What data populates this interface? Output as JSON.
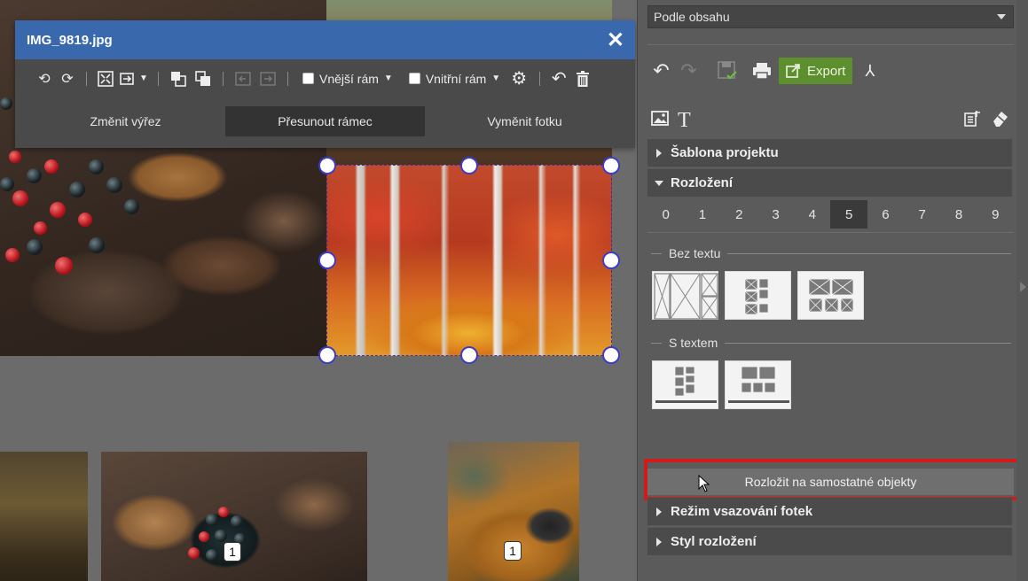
{
  "dialog": {
    "title": "IMG_9819.jpg",
    "toolbar": {
      "outer_frame_label": "Vnější rám",
      "inner_frame_label": "Vnitřní rám"
    },
    "tabs": [
      "Změnit výřez",
      "Přesunout rámec",
      "Vyměnit fotku"
    ],
    "active_tab": "Přesunout rámec"
  },
  "canvas": {
    "badges": [
      "1",
      "1"
    ]
  },
  "panel": {
    "layout_select": "Podle obsahu",
    "export_label": "Export",
    "sections": {
      "project_template": "Šablona projektu",
      "layout": "Rozložení",
      "photo_insertion_mode": "Režim vsazování fotek",
      "layout_style": "Styl rozložení"
    },
    "photo_counts": [
      "0",
      "1",
      "2",
      "3",
      "4",
      "5",
      "6",
      "7",
      "8",
      "9"
    ],
    "active_count": "5",
    "groups": {
      "without_text": "Bez textu",
      "with_text": "S textem"
    },
    "split_button": "Rozložit na samostatné objekty"
  },
  "colors": {
    "dialog_titlebar": "#3968ad",
    "export_green": "#5d8f2f",
    "highlight_red": "#d21a1a",
    "selection_handle": "#3c3cc8"
  }
}
